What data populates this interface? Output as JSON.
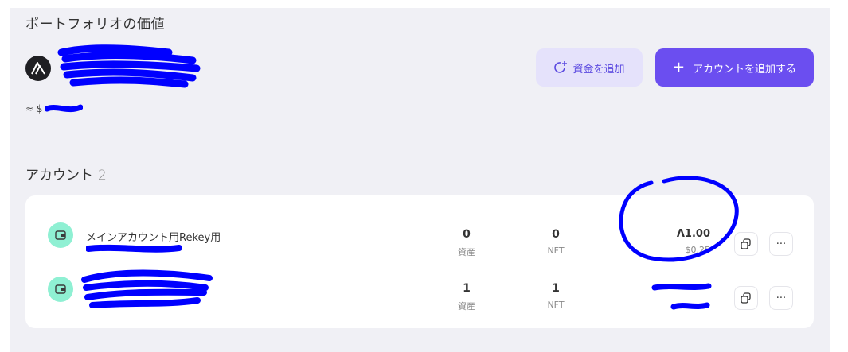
{
  "header": {
    "title": "ポートフォリオの価値"
  },
  "portfolio": {
    "approx_prefix": "≈ $"
  },
  "buttons": {
    "add_funds": "資金を追加",
    "add_account": "アカウントを追加する"
  },
  "accounts": {
    "heading": "アカウント",
    "count": "2",
    "rows": [
      {
        "name": "メインアカウント用Rekey用",
        "assets": "0",
        "assets_label": "資産",
        "nft": "0",
        "nft_label": "NFT",
        "algo": "Λ1.00",
        "usd": "$0.25"
      },
      {
        "name": "",
        "assets": "1",
        "assets_label": "資産",
        "nft": "1",
        "nft_label": "NFT",
        "algo": "",
        "usd": ""
      }
    ]
  },
  "icons": [
    "algorand-logo-icon",
    "add-funds-icon",
    "plus-icon",
    "wallet-icon",
    "copy-icon",
    "more-icon"
  ],
  "colors": {
    "accent": "#6b4ef0",
    "accent_light": "#e5e2fb",
    "wallet_bg": "#8ff0d3",
    "redaction": "#0000ff"
  }
}
